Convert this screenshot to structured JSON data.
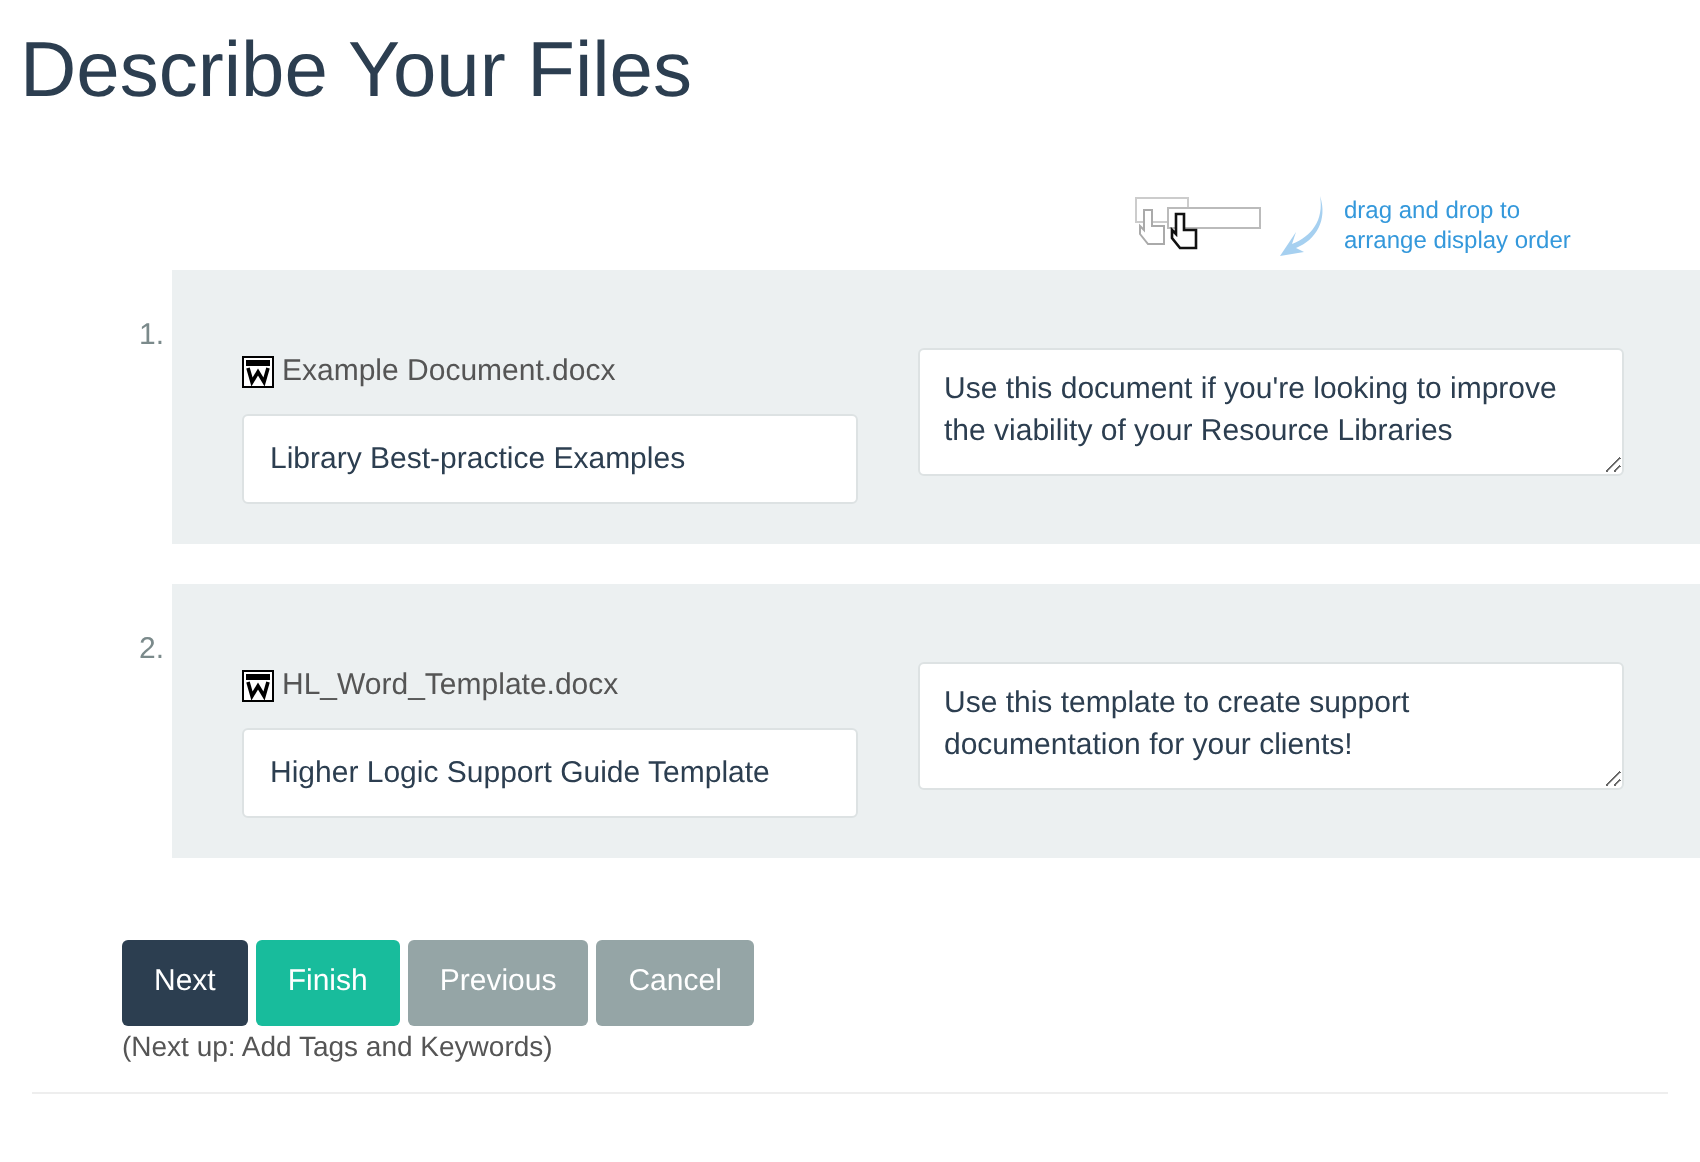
{
  "title": "Describe Your Files",
  "hint": "drag and drop to arrange display order",
  "files": [
    {
      "number": "1.",
      "filename": "Example Document.docx",
      "title": "Library Best-practice Examples",
      "description": "Use this document if you're looking to improve the viability of your Resource Libraries"
    },
    {
      "number": "2.",
      "filename": "HL_Word_Template.docx",
      "title": "Higher Logic Support Guide Template",
      "description": "Use this template to create support documentation for your clients!"
    }
  ],
  "buttons": [
    {
      "label": "Next",
      "kind": "primary"
    },
    {
      "label": "Finish",
      "kind": "success"
    },
    {
      "label": "Previous",
      "kind": "default"
    },
    {
      "label": "Cancel",
      "kind": "default"
    }
  ],
  "next_up": "(Next up: Add Tags and Keywords)"
}
